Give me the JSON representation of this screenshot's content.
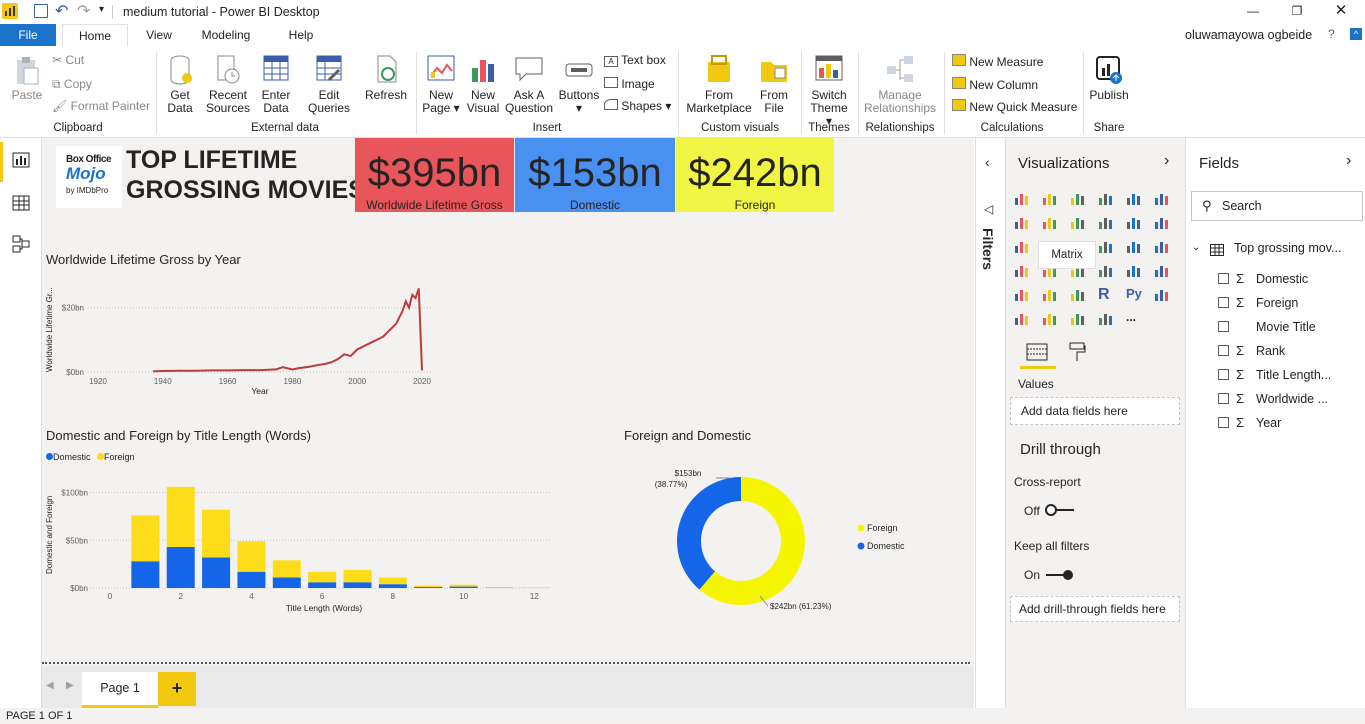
{
  "window": {
    "title": "medium tutorial - Power BI Desktop",
    "user": "oluwamayowa ogbeide"
  },
  "tabs": [
    "File",
    "Home",
    "View",
    "Modeling",
    "Help"
  ],
  "ribbon": {
    "clipboard": {
      "paste": "Paste",
      "cut": "Cut",
      "copy": "Copy",
      "format_painter": "Format Painter",
      "group": "Clipboard"
    },
    "external": {
      "get_data": "Get Data",
      "recent_sources": "Recent Sources",
      "enter_data": "Enter Data",
      "edit_queries": "Edit Queries",
      "refresh": "Refresh",
      "group": "External data"
    },
    "insert": {
      "new_page": "New Page",
      "new_visual": "New Visual",
      "ask_question": "Ask A Question",
      "buttons": "Buttons",
      "text_box": "Text box",
      "image": "Image",
      "shapes": "Shapes",
      "group": "Insert"
    },
    "custom": {
      "from_marketplace": "From Marketplace",
      "from_file": "From File",
      "group": "Custom visuals"
    },
    "themes": {
      "switch_theme": "Switch Theme",
      "group": "Themes"
    },
    "relationships": {
      "manage": "Manage Relationships",
      "group": "Relationships"
    },
    "calculations": {
      "new_measure": "New Measure",
      "new_column": "New Column",
      "new_quick_measure": "New Quick Measure",
      "group": "Calculations"
    },
    "share": {
      "publish": "Publish",
      "group": "Share"
    }
  },
  "report": {
    "logo": {
      "line1": "Box Office",
      "line2": "Mojo",
      "line3": "by IMDbPro"
    },
    "title_line1": "TOP LIFETIME",
    "title_line2": "GROSSING MOVIES",
    "cards": [
      {
        "value": "$395bn",
        "label": "Worldwide Lifetime Gross",
        "color": "#e8555a"
      },
      {
        "value": "$153bn",
        "label": "Domestic",
        "color": "#4a90f0"
      },
      {
        "value": "$242bn",
        "label": "Foreign",
        "color": "#f1f545"
      }
    ]
  },
  "chart_data": [
    {
      "type": "line",
      "title": "Worldwide Lifetime Gross by Year",
      "xlabel": "Year",
      "ylabel": "Worldwide Lifetime Gr...",
      "xlim": [
        1920,
        2020
      ],
      "ylim": [
        0,
        28
      ],
      "x_ticks": [
        "1920",
        "1940",
        "1960",
        "1980",
        "2000",
        "2020"
      ],
      "y_ticks": [
        "$0bn",
        "$20bn"
      ],
      "color": "#c0393b",
      "x": [
        1937,
        1940,
        1945,
        1950,
        1955,
        1960,
        1965,
        1970,
        1975,
        1977,
        1980,
        1982,
        1985,
        1988,
        1990,
        1992,
        1994,
        1996,
        1998,
        2000,
        2002,
        2004,
        2006,
        2008,
        2010,
        2012,
        2014,
        2015,
        2016,
        2017,
        2018,
        2019,
        2020
      ],
      "y": [
        0.2,
        0.3,
        0.4,
        0.4,
        0.5,
        0.5,
        0.6,
        0.6,
        0.8,
        1.5,
        0.8,
        1.2,
        1.6,
        2.2,
        2.5,
        3,
        4,
        5.5,
        5,
        7,
        8,
        9,
        10,
        11,
        13,
        15,
        19,
        22,
        20,
        24,
        23,
        26,
        0.5
      ]
    },
    {
      "type": "bar",
      "title": "Domestic and Foreign by Title Length (Words)",
      "xlabel": "Title Length (Words)",
      "ylabel": "Domestic and Foreign",
      "xlim": [
        0,
        12.5
      ],
      "ylim": [
        0,
        110
      ],
      "x_ticks": [
        "0",
        "2",
        "4",
        "6",
        "8",
        "10",
        "12"
      ],
      "y_ticks": [
        "$0bn",
        "$50bn",
        "$100bn"
      ],
      "x": [
        1,
        2,
        3,
        4,
        5,
        6,
        7,
        8,
        9,
        10,
        11,
        12
      ],
      "series": [
        {
          "name": "Domestic",
          "color": "#1565e9",
          "values": [
            28,
            43,
            32,
            17,
            11,
            6,
            6,
            4,
            1,
            1.5,
            0.3,
            0.2
          ]
        },
        {
          "name": "Foreign",
          "color": "#fddd1a",
          "values": [
            48,
            63,
            50,
            32,
            18,
            11,
            13,
            7,
            1.5,
            2,
            0.5,
            0.3
          ]
        }
      ]
    },
    {
      "type": "pie",
      "title": "Foreign and Domestic",
      "labels": [
        "Foreign",
        "Domestic"
      ],
      "values": [
        242,
        153
      ],
      "colors": [
        "#f5f500",
        "#1565e9"
      ],
      "annotations": [
        [
          "$153bn",
          "(38.77%)"
        ],
        [
          "$242bn (61.23%)"
        ]
      ]
    }
  ],
  "page_tabs": {
    "page1": "Page 1",
    "add": "+"
  },
  "status": "PAGE 1 OF 1",
  "filters_label": "Filters",
  "visualizations": {
    "title": "Visualizations",
    "tooltip": "Matrix",
    "values_label": "Values",
    "add_values": "Add data fields here",
    "drill_through": "Drill through",
    "cross_report": "Cross-report",
    "cross_report_state": "Off",
    "keep_filters": "Keep all filters",
    "keep_filters_state": "On",
    "add_drill": "Add drill-through fields here",
    "more": "..."
  },
  "fields_pane": {
    "title": "Fields",
    "search_placeholder": "Search",
    "table": "Top grossing mov...",
    "fields": [
      {
        "name": "Domestic",
        "sigma": true
      },
      {
        "name": "Foreign",
        "sigma": true
      },
      {
        "name": "Movie Title",
        "sigma": false
      },
      {
        "name": "Rank",
        "sigma": true
      },
      {
        "name": "Title Length...",
        "sigma": true
      },
      {
        "name": "Worldwide ...",
        "sigma": true
      },
      {
        "name": "Year",
        "sigma": true
      }
    ]
  }
}
